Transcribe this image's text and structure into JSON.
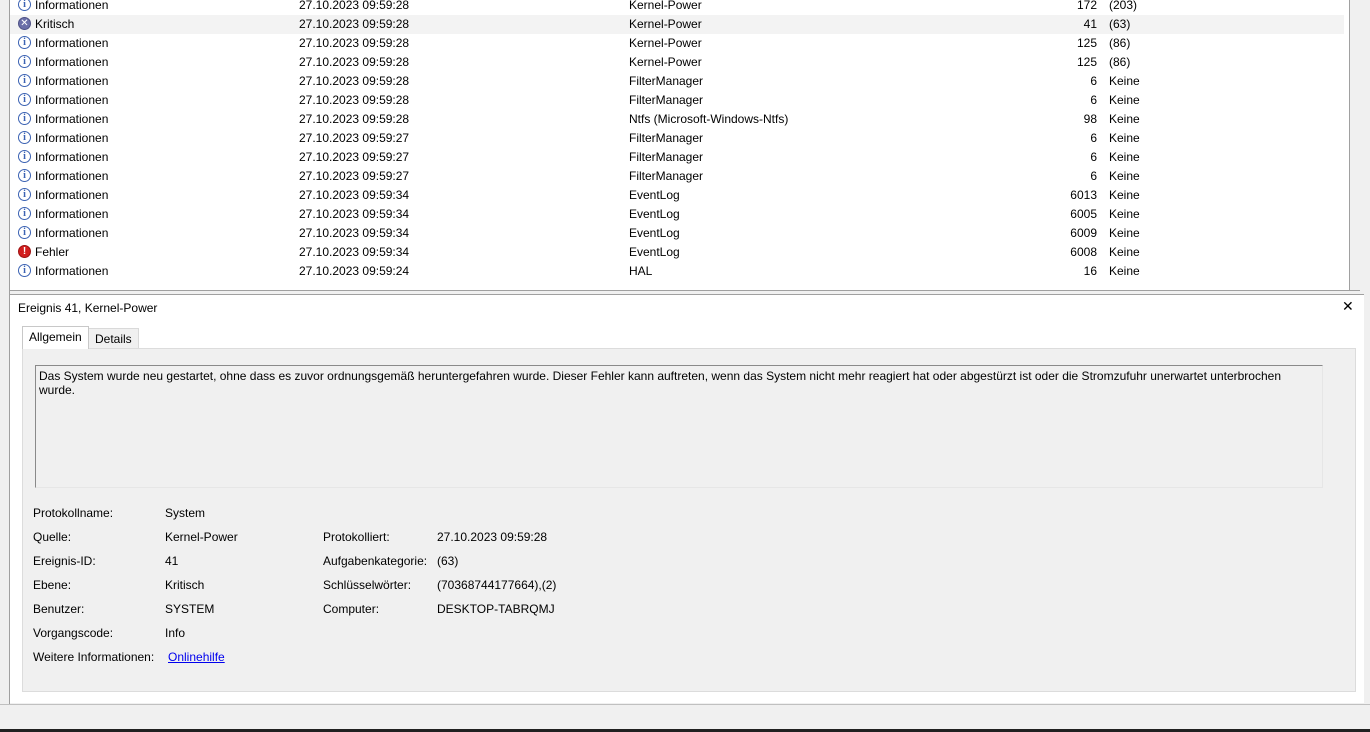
{
  "events": [
    {
      "icon": "info",
      "level": "Informationen",
      "date": "27.10.2023 09:59:28",
      "source": "Kernel-Power",
      "id": "172",
      "task": "(203)"
    },
    {
      "icon": "critical",
      "level": "Kritisch",
      "date": "27.10.2023 09:59:28",
      "source": "Kernel-Power",
      "id": "41",
      "task": "(63)"
    },
    {
      "icon": "info",
      "level": "Informationen",
      "date": "27.10.2023 09:59:28",
      "source": "Kernel-Power",
      "id": "125",
      "task": "(86)"
    },
    {
      "icon": "info",
      "level": "Informationen",
      "date": "27.10.2023 09:59:28",
      "source": "Kernel-Power",
      "id": "125",
      "task": "(86)"
    },
    {
      "icon": "info",
      "level": "Informationen",
      "date": "27.10.2023 09:59:28",
      "source": "FilterManager",
      "id": "6",
      "task": "Keine"
    },
    {
      "icon": "info",
      "level": "Informationen",
      "date": "27.10.2023 09:59:28",
      "source": "FilterManager",
      "id": "6",
      "task": "Keine"
    },
    {
      "icon": "info",
      "level": "Informationen",
      "date": "27.10.2023 09:59:28",
      "source": "Ntfs (Microsoft-Windows-Ntfs)",
      "id": "98",
      "task": "Keine"
    },
    {
      "icon": "info",
      "level": "Informationen",
      "date": "27.10.2023 09:59:27",
      "source": "FilterManager",
      "id": "6",
      "task": "Keine"
    },
    {
      "icon": "info",
      "level": "Informationen",
      "date": "27.10.2023 09:59:27",
      "source": "FilterManager",
      "id": "6",
      "task": "Keine"
    },
    {
      "icon": "info",
      "level": "Informationen",
      "date": "27.10.2023 09:59:27",
      "source": "FilterManager",
      "id": "6",
      "task": "Keine"
    },
    {
      "icon": "info",
      "level": "Informationen",
      "date": "27.10.2023 09:59:34",
      "source": "EventLog",
      "id": "6013",
      "task": "Keine"
    },
    {
      "icon": "info",
      "level": "Informationen",
      "date": "27.10.2023 09:59:34",
      "source": "EventLog",
      "id": "6005",
      "task": "Keine"
    },
    {
      "icon": "info",
      "level": "Informationen",
      "date": "27.10.2023 09:59:34",
      "source": "EventLog",
      "id": "6009",
      "task": "Keine"
    },
    {
      "icon": "error",
      "level": "Fehler",
      "date": "27.10.2023 09:59:34",
      "source": "EventLog",
      "id": "6008",
      "task": "Keine"
    },
    {
      "icon": "info",
      "level": "Informationen",
      "date": "27.10.2023 09:59:24",
      "source": "HAL",
      "id": "16",
      "task": "Keine"
    }
  ],
  "detail": {
    "title": "Ereignis 41, Kernel-Power",
    "close_symbol": "✕",
    "tabs": {
      "general": "Allgemein",
      "details": "Details"
    },
    "description": "Das System wurde neu gestartet, ohne dass es zuvor ordnungsgemäß heruntergefahren wurde. Dieser Fehler kann auftreten, wenn das System nicht mehr reagiert hat oder abgestürzt ist oder die Stromzufuhr unerwartet unterbrochen wurde.",
    "labels": {
      "log_name": "Protokollname:",
      "source": "Quelle:",
      "event_id": "Ereignis-ID:",
      "level": "Ebene:",
      "user": "Benutzer:",
      "opcode": "Vorgangscode:",
      "more_info": "Weitere Informationen:",
      "logged": "Protokolliert:",
      "task_category": "Aufgabenkategorie:",
      "keywords": "Schlüsselwörter:",
      "computer": "Computer:"
    },
    "values": {
      "log_name": "System",
      "source": "Kernel-Power",
      "event_id": "41",
      "level": "Kritisch",
      "user": "SYSTEM",
      "opcode": "Info",
      "more_info_link": "Onlinehilfe",
      "logged": "27.10.2023 09:59:28",
      "task_category": "(63)",
      "keywords": "(70368744177664),(2)",
      "computer": "DESKTOP-TABRQMJ"
    }
  }
}
